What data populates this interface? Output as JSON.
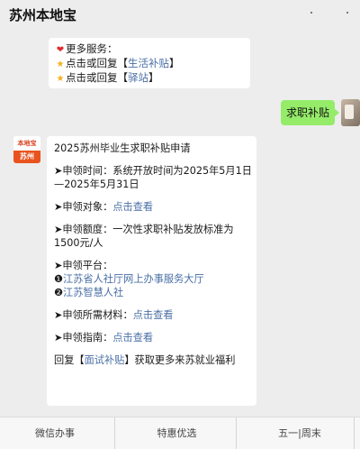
{
  "header": {
    "title": "苏州本地宝"
  },
  "messages": {
    "services": {
      "line1": "更多服务：",
      "line2_prefix": "点击或回复【",
      "line2_link": "生活补贴",
      "line2_suffix": "】",
      "line3_prefix": "点击或回复【",
      "line3_link": "驿站",
      "line3_suffix": "】"
    },
    "user_reply": "求职补贴",
    "bot_avatar": {
      "top": "本地宝",
      "bottom": "苏州"
    },
    "article": {
      "title": "2025苏州毕业生求职补贴申请",
      "time_label": "➤申领时间：系统开放时间为2025年5月1日",
      "time_cont": "—2025年5月31日",
      "target_label": "➤申领对象：",
      "target_link": "点击查看",
      "amount_label": "➤申领额度：一次性求职补贴发放标准为",
      "amount_cont": "1500元/人",
      "platform_label": "➤申领平台：",
      "platform1_num": "❶",
      "platform1_link": "江苏省人社厅网上办事服务大厅",
      "platform2_num": "❷",
      "platform2_link": "江苏智慧人社",
      "materials_label": "➤申领所需材料：",
      "materials_link": "点击查看",
      "guide_label": "➤申领指南：",
      "guide_link": "点击查看",
      "footer_prefix": "回复【",
      "footer_link": "面试补贴",
      "footer_suffix": "】获取更多来苏就业福利"
    }
  },
  "tabbar": {
    "tab1": "微信办事",
    "tab2": "特惠优选",
    "tab3": "五一|周末"
  },
  "icons": {
    "heart": "heart-icon",
    "star": "star-icon",
    "more": "more-dots-icon"
  },
  "colors": {
    "link": "#4a6fa5",
    "outgoing_bubble": "#95ec69",
    "background": "#ededed"
  }
}
